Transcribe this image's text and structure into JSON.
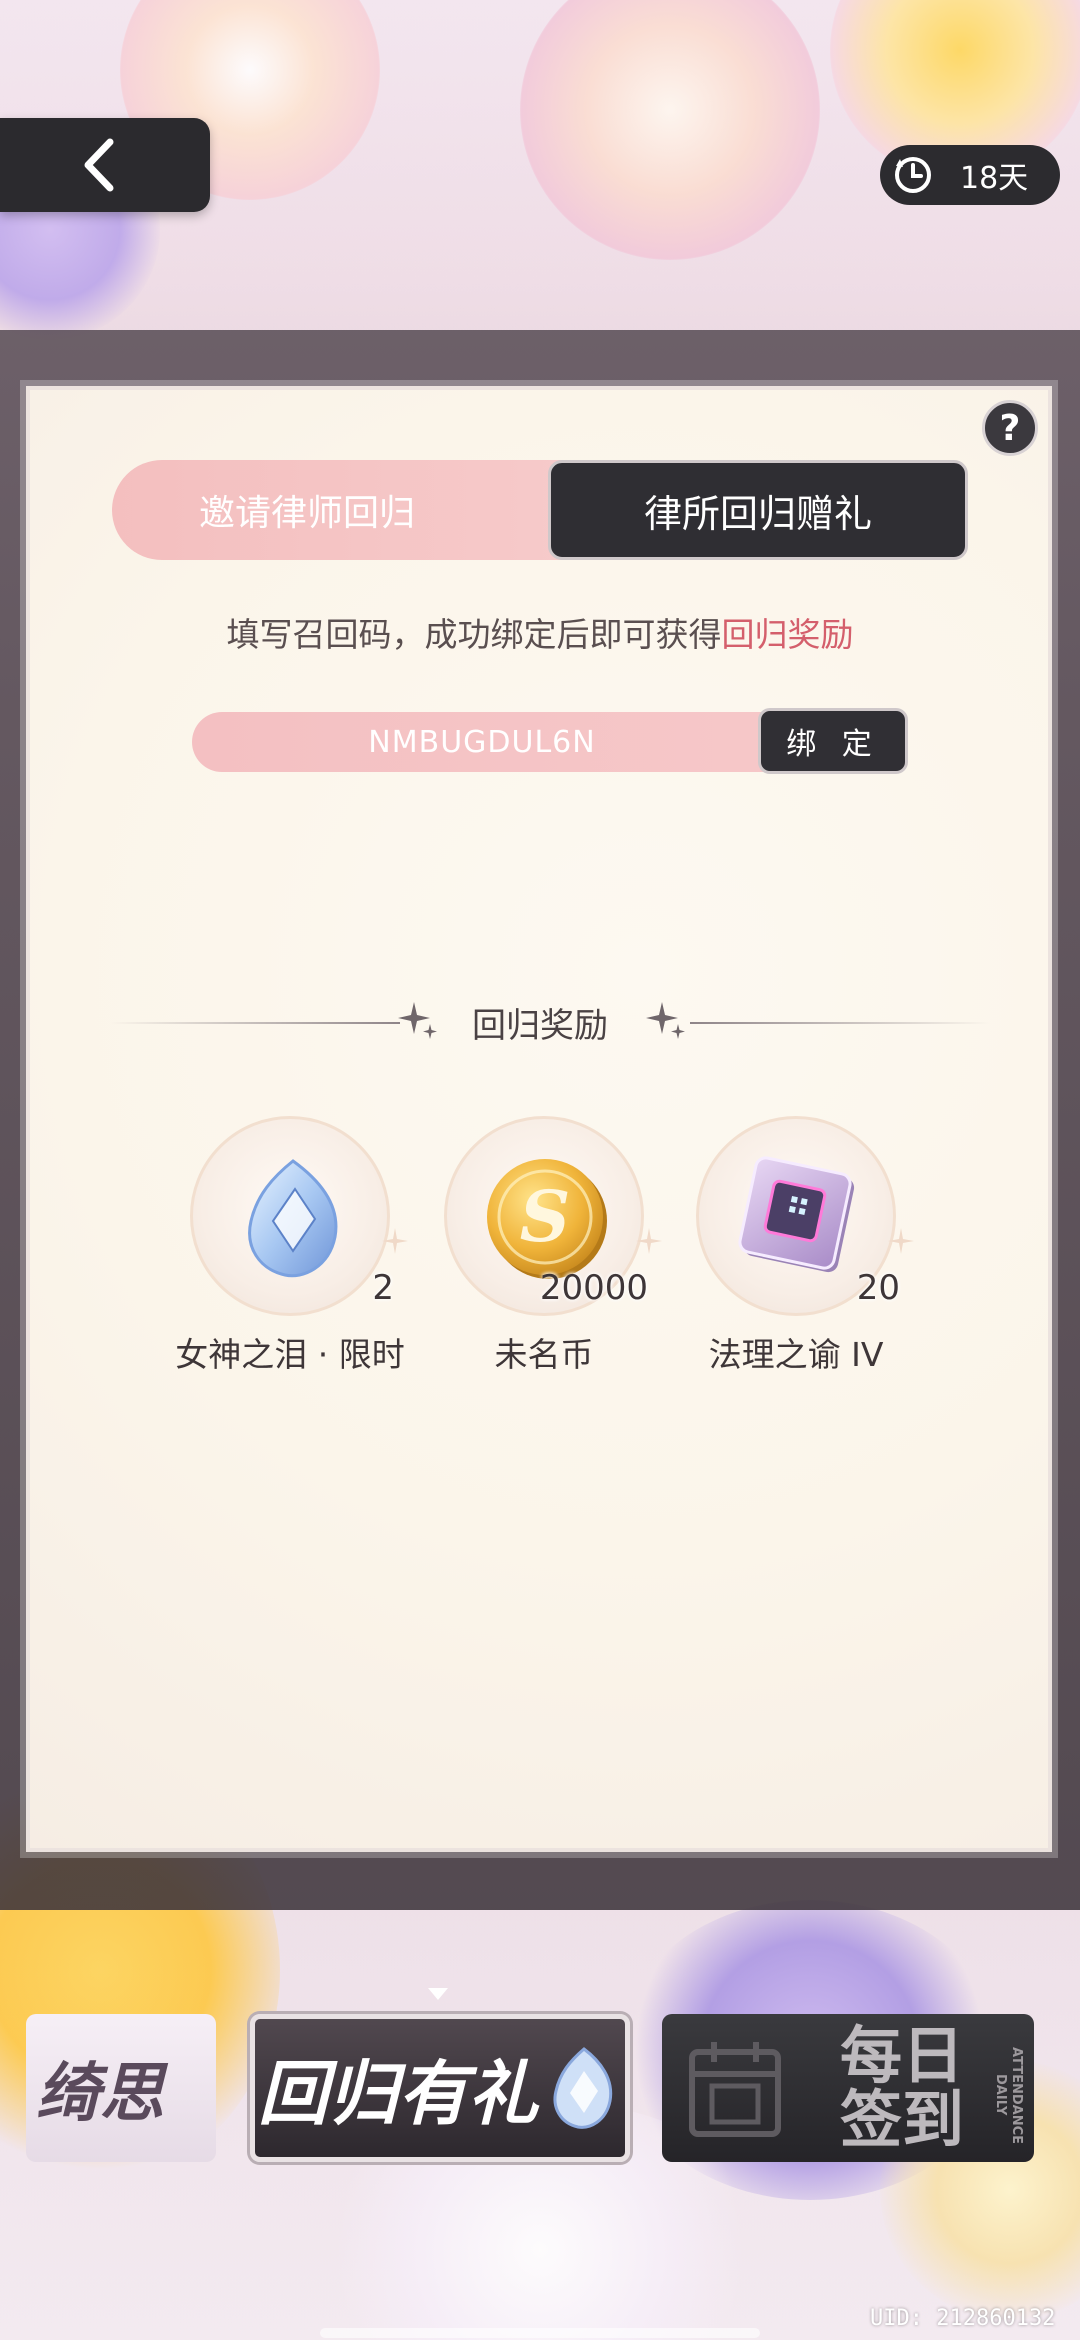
{
  "header": {
    "timer_label": "18天"
  },
  "tabs": [
    {
      "label": "邀请律师回归"
    },
    {
      "label": "律所回归赠礼"
    }
  ],
  "description": {
    "prefix": "填写召回码，成功绑定后即可获得",
    "highlight": "回归奖励"
  },
  "code": {
    "value": "NMBUGDUL6N",
    "bind_label": "绑 定"
  },
  "rewards": {
    "title": "回归奖励",
    "items": [
      {
        "name": "女神之泪 · 限时",
        "qty": "2",
        "icon": "teardrop-gem-icon"
      },
      {
        "name": "未名币",
        "qty": "20000",
        "icon": "gold-coin-icon"
      },
      {
        "name": "法理之谕 IV",
        "qty": "20",
        "icon": "data-chip-icon"
      }
    ]
  },
  "bottom_tabs": {
    "tab1": "绮思",
    "tab2": "回归有礼",
    "tab3_line1": "每日",
    "tab3_line2": "签到",
    "tab3_side": "ATTENDANCE DAILY"
  },
  "footer": {
    "uid": "UID: 212860132"
  },
  "colors": {
    "accent_pink": "#f4bfbf",
    "highlight_red": "#d45f6c",
    "dark_button": "#2f2e33"
  }
}
